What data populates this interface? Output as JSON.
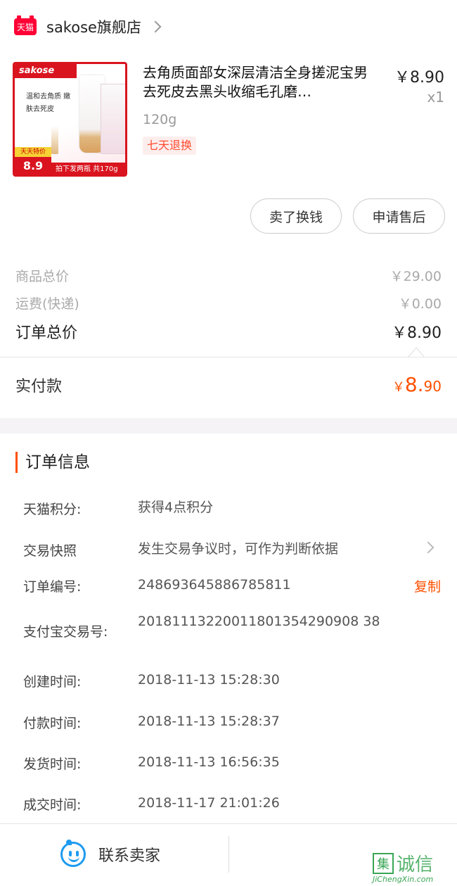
{
  "store": {
    "badge": "天猫",
    "name": "sakose旗舰店"
  },
  "product": {
    "title": "去角质面部女深层清洁全身搓泥宝男去死皮去黑头收缩毛孔磨…",
    "sku": "120g",
    "return_badge": "七天退换",
    "price": "￥8.90",
    "quantity": "x1",
    "thumb": {
      "brand": "sakose",
      "slogan": "温和去角质 嫩肤去死皮",
      "deal_label": "天天特价",
      "deal_price": "8.9",
      "bottom_text": "拍下发两瓶 共170g"
    }
  },
  "actions": {
    "sell_label": "卖了换钱",
    "after_sales_label": "申请售后"
  },
  "summary": {
    "goods_label": "商品总价",
    "goods_value": "￥29.00",
    "shipping_label": "运费(快递)",
    "shipping_value": "￥0.00",
    "total_label": "订单总价",
    "total_value": "￥8.90",
    "paid_label": "实付款",
    "paid_currency": "￥",
    "paid_int": "8.",
    "paid_dec": "90"
  },
  "order_info": {
    "title": "订单信息",
    "points_label": "天猫积分:",
    "points_value": "获得4点积分",
    "snapshot_label": "交易快照",
    "snapshot_value": "发生交易争议时，可作为判断依据",
    "order_no_label": "订单编号:",
    "order_no_value": "248693645886785811",
    "copy_label": "复制",
    "alipay_label": "支付宝交易号:",
    "alipay_value": "20181113220011801354290908 38",
    "created_label": "创建时间:",
    "created_value": "2018-11-13 15:28:30",
    "paid_label": "付款时间:",
    "paid_value": "2018-11-13 15:28:37",
    "shipped_label": "发货时间:",
    "shipped_value": "2018-11-13 16:56:35",
    "closed_label": "成交时间:",
    "closed_value": "2018-11-17 21:01:26"
  },
  "bottom": {
    "contact_label": "联系卖家"
  },
  "watermark": {
    "box": "集",
    "text": "诚信",
    "sub": "JiChengXin.com"
  },
  "colors": {
    "accent": "#ff5000",
    "tmall_red": "#ff0036",
    "contact_blue": "#1e9bf0"
  }
}
